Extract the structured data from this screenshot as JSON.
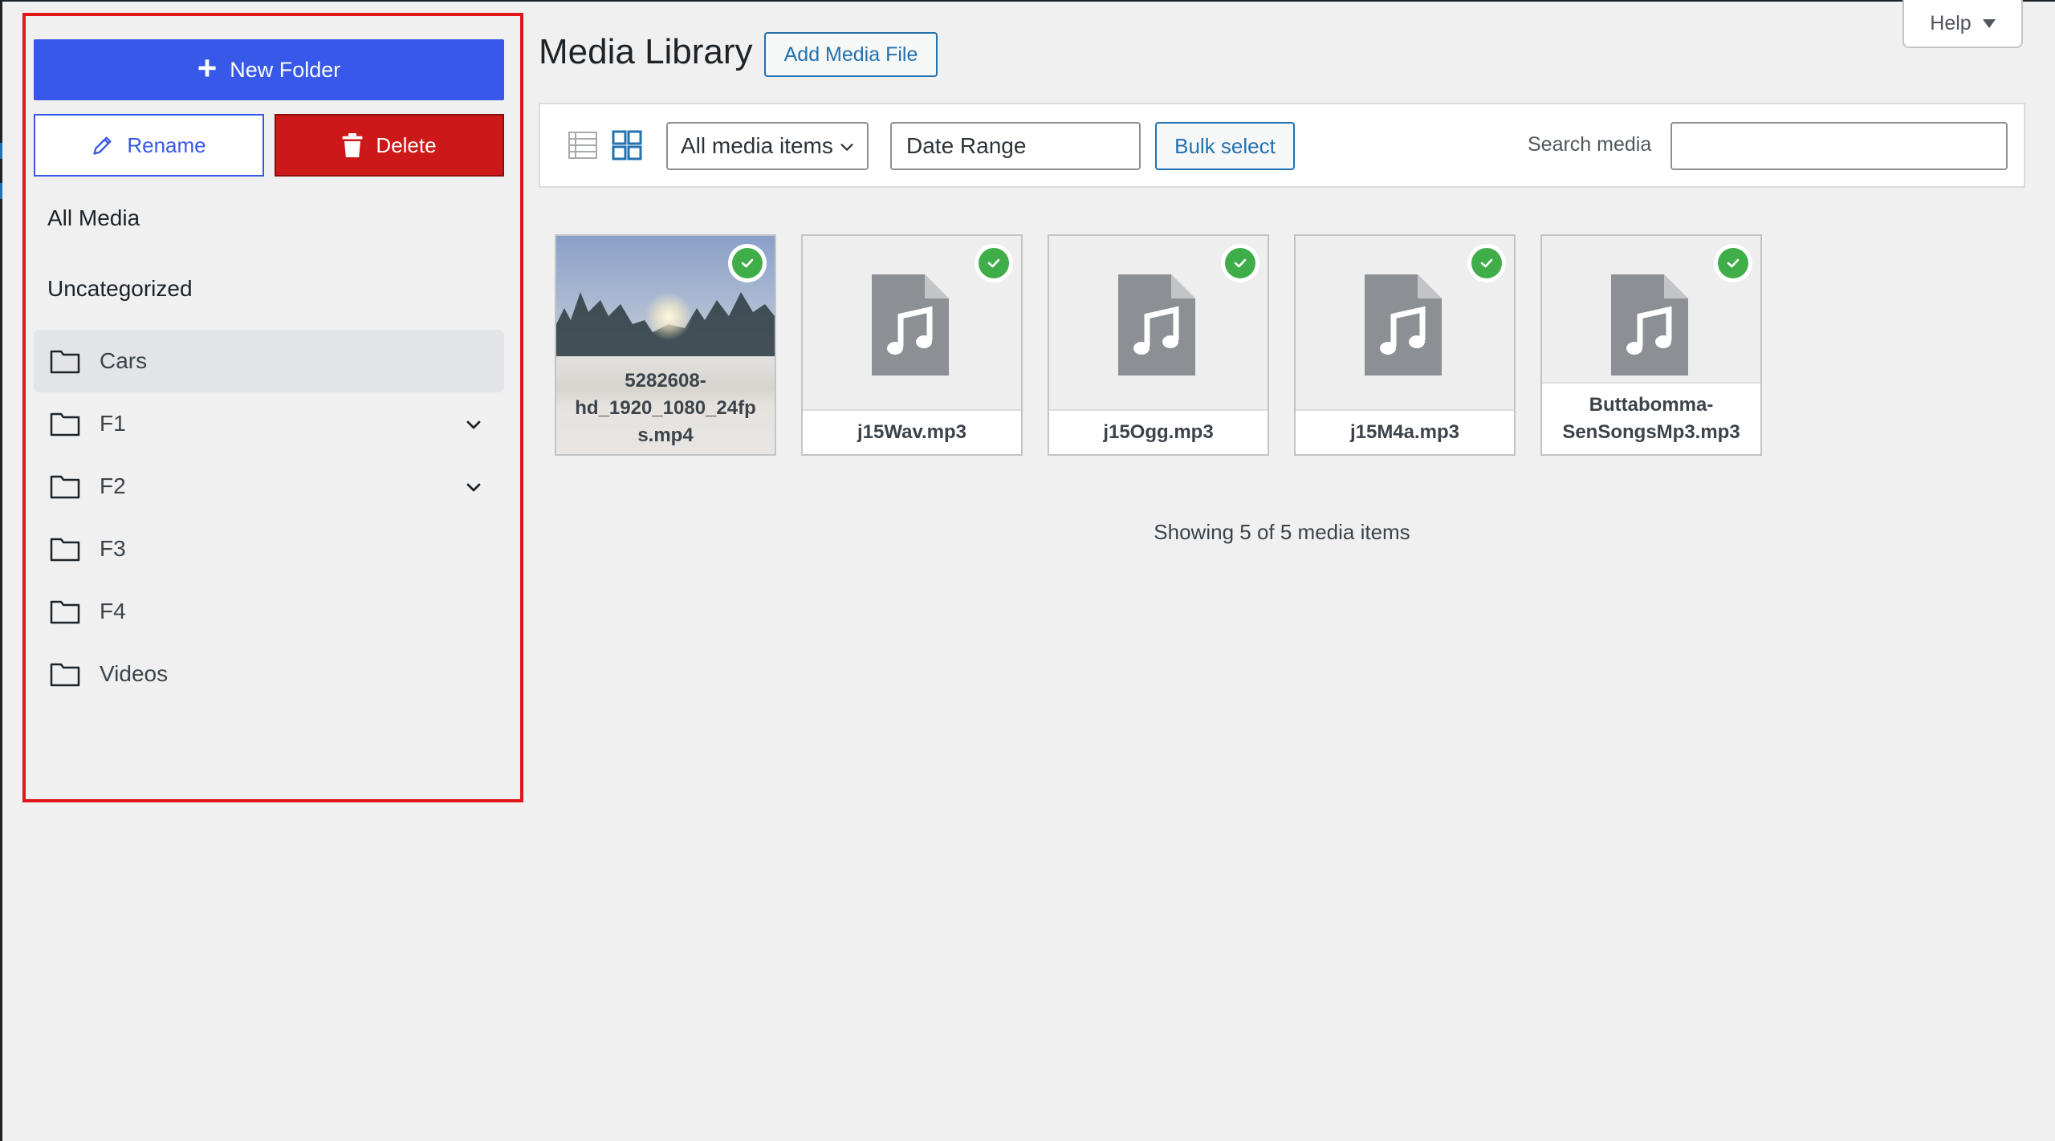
{
  "folder_panel": {
    "new_folder_label": "New Folder",
    "rename_label": "Rename",
    "delete_label": "Delete",
    "all_media_label": "All Media",
    "uncategorized_label": "Uncategorized",
    "folders": [
      {
        "label": "Cars",
        "active": true,
        "expandable": false
      },
      {
        "label": "F1",
        "active": false,
        "expandable": true
      },
      {
        "label": "F2",
        "active": false,
        "expandable": true
      },
      {
        "label": "F3",
        "active": false,
        "expandable": false
      },
      {
        "label": "F4",
        "active": false,
        "expandable": false
      },
      {
        "label": "Videos",
        "active": false,
        "expandable": false
      }
    ]
  },
  "header": {
    "title": "Media Library",
    "add_media_label": "Add Media File",
    "help_label": "Help"
  },
  "toolbar": {
    "filter_selected": "All media items",
    "date_range_label": "Date Range",
    "bulk_select_label": "Bulk select",
    "search_label": "Search media",
    "search_value": ""
  },
  "media_items": [
    {
      "filename": "5282608-hd_1920_1080_24fps.mp4",
      "caption_lines": [
        "5282608-",
        "hd_1920_1080_24fp",
        "s.mp4"
      ],
      "type": "video",
      "selected": true
    },
    {
      "filename": "j15Wav.mp3",
      "caption_lines": [
        "j15Wav.mp3"
      ],
      "type": "audio",
      "selected": true
    },
    {
      "filename": "j15Ogg.mp3",
      "caption_lines": [
        "j15Ogg.mp3"
      ],
      "type": "audio",
      "selected": true
    },
    {
      "filename": "j15M4a.mp3",
      "caption_lines": [
        "j15M4a.mp3"
      ],
      "type": "audio",
      "selected": true
    },
    {
      "filename": "Buttabomma-SenSongsMp3.mp3",
      "caption_lines": [
        "Buttabomma-",
        "SenSongsMp3.mp3"
      ],
      "type": "audio",
      "selected": true
    }
  ],
  "footer": {
    "showing_text": "Showing 5 of 5 media items"
  },
  "colors": {
    "primary_blue": "#3858e9",
    "link_blue": "#2271b1",
    "delete_red": "#cc1818",
    "highlight_border": "#e0161b",
    "check_green": "#3fae49"
  }
}
